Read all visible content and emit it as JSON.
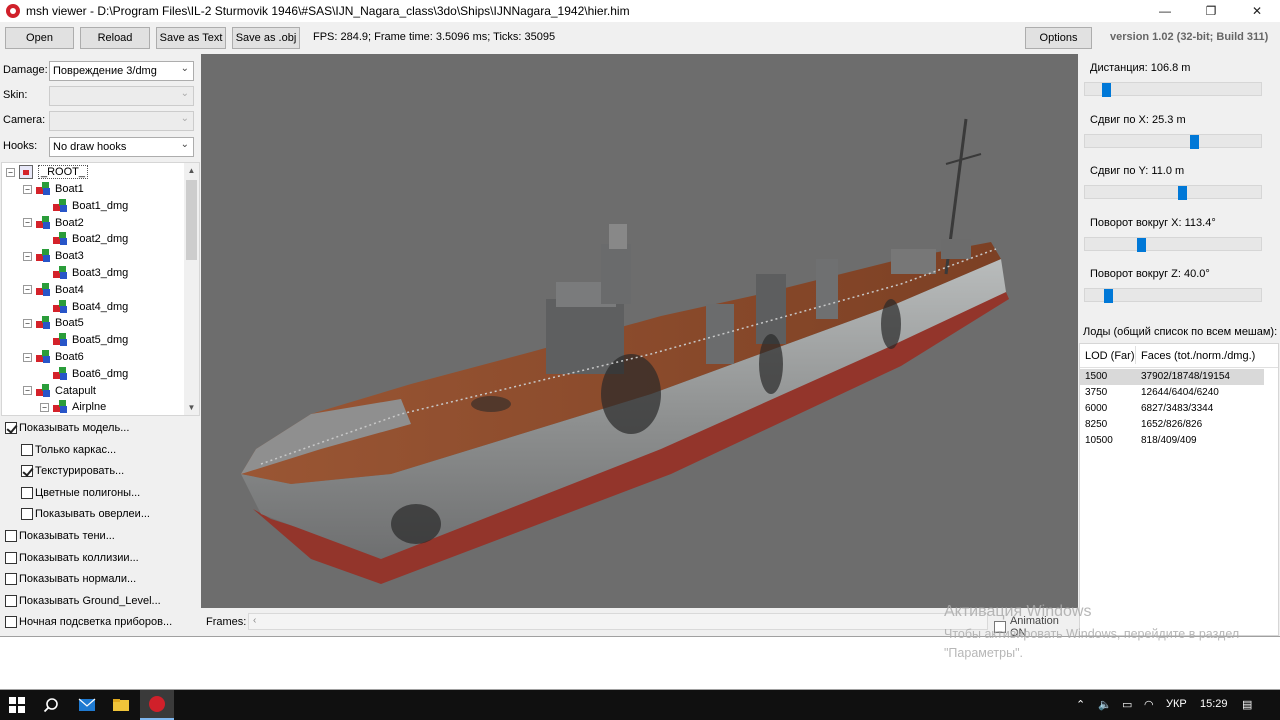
{
  "window": {
    "title": "msh viewer - D:\\Program Files\\IL-2 Sturmovik 1946\\#SAS\\IJN_Nagara_class\\3do\\Ships\\IJNNagara_1942\\hier.him",
    "minimize": "—",
    "maximize": "❐",
    "close": "✕"
  },
  "toolbar": {
    "open": "Open",
    "reload": "Reload",
    "save_text": "Save as Text",
    "save_obj": "Save as .obj",
    "stats": "FPS: 284.9; Frame time: 3.5096 ms; Ticks: 35095",
    "options": "Options",
    "version": "version 1.02 (32-bit; Build 311)"
  },
  "props": {
    "damage_label": "Damage:",
    "damage_value": "Повреждение 3/dmg",
    "skin_label": "Skin:",
    "skin_value": "",
    "camera_label": "Camera:",
    "camera_value": "",
    "hooks_label": "Hooks:",
    "hooks_value": "No draw hooks"
  },
  "tree": {
    "root": "_ROOT_",
    "items": [
      {
        "label": "Boat1",
        "level": 1,
        "expander": "−"
      },
      {
        "label": "Boat1_dmg",
        "level": 2,
        "expander": ""
      },
      {
        "label": "Boat2",
        "level": 1,
        "expander": "−"
      },
      {
        "label": "Boat2_dmg",
        "level": 2,
        "expander": ""
      },
      {
        "label": "Boat3",
        "level": 1,
        "expander": "−"
      },
      {
        "label": "Boat3_dmg",
        "level": 2,
        "expander": ""
      },
      {
        "label": "Boat4",
        "level": 1,
        "expander": "−"
      },
      {
        "label": "Boat4_dmg",
        "level": 2,
        "expander": ""
      },
      {
        "label": "Boat5",
        "level": 1,
        "expander": "−"
      },
      {
        "label": "Boat5_dmg",
        "level": 2,
        "expander": ""
      },
      {
        "label": "Boat6",
        "level": 1,
        "expander": "−"
      },
      {
        "label": "Boat6_dmg",
        "level": 2,
        "expander": ""
      },
      {
        "label": "Catapult",
        "level": 1,
        "expander": "−"
      },
      {
        "label": "Airplne",
        "level": 2,
        "expander": "−"
      }
    ]
  },
  "checkboxes": [
    {
      "label": "Показывать модель...",
      "checked": true
    },
    {
      "label": "Только каркас...",
      "checked": false
    },
    {
      "label": "Текстурировать...",
      "checked": true
    },
    {
      "label": "Цветные полигоны...",
      "checked": false
    },
    {
      "label": "Показывать оверлеи...",
      "checked": false
    },
    {
      "label": "Показывать тени...",
      "checked": false
    },
    {
      "label": "Показывать коллизии...",
      "checked": false
    },
    {
      "label": "Показывать нормали...",
      "checked": false
    },
    {
      "label": "Показывать Ground_Level...",
      "checked": false
    },
    {
      "label": "Ночная подсветка приборов...",
      "checked": false
    }
  ],
  "frames": {
    "label": "Frames:",
    "animation": "Animation ON",
    "animation_checked": false
  },
  "sliders": [
    {
      "label": "Дистанция:  106.8 m",
      "level": 0.1
    },
    {
      "label": "Сдвиг по X:  25.3 m",
      "level": 0.62
    },
    {
      "label": "Сдвиг по Y:  11.0 m",
      "level": 0.55
    },
    {
      "label": "Поворот вокруг X:  113.4°",
      "level": 0.31
    },
    {
      "label": "Поворот вокруг Z:  40.0°",
      "level": 0.11
    }
  ],
  "lods": {
    "title": "Лоды (общий список по всем мешам):",
    "col_lod": "LOD (Far)",
    "col_faces": "Faces (tot./norm./dmg.)",
    "rows": [
      {
        "lod": "1500",
        "faces": "37902/18748/19154",
        "selected": true
      },
      {
        "lod": "3750",
        "faces": "12644/6404/6240",
        "selected": false
      },
      {
        "lod": "6000",
        "faces": "6827/3483/3344",
        "selected": false
      },
      {
        "lod": "8250",
        "faces": "1652/826/826",
        "selected": false
      },
      {
        "lod": "10500",
        "faces": "818/409/409",
        "selected": false
      }
    ]
  },
  "watermark": {
    "title": "Активация Windows",
    "body": "Чтобы активировать Windows, перейдите в раздел \"Параметры\"."
  },
  "taskbar": {
    "lang": "УКР",
    "time": "15:29",
    "icons": [
      "windows-start-icon",
      "search-icon",
      "mail-icon",
      "file-explorer-icon",
      "msh-viewer-icon"
    ]
  },
  "colors": {
    "accent": "#0078d7",
    "viewport": "#6d6d6d",
    "taskbar": "#101010"
  }
}
